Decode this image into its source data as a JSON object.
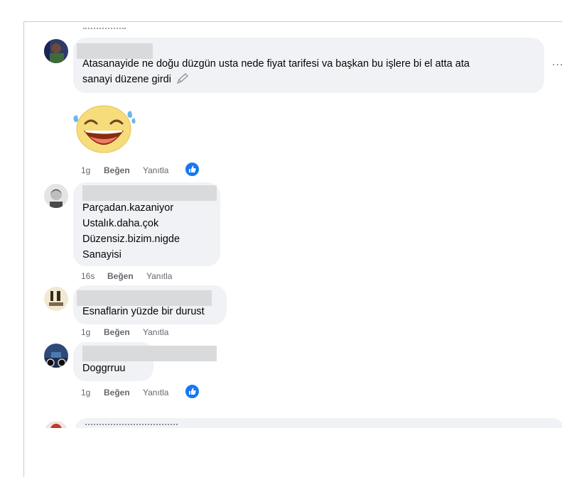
{
  "comments": [
    {
      "text_line1": "Atasanayide ne doğu düzgün usta nede fiyat tarifesi va başkan bu işlere bi el atta ata",
      "text_line2": "sanayi düzene girdi",
      "time": "1g",
      "like": "Beğen",
      "reply": "Yanıtla",
      "reaction": "like-icon",
      "sticker": "laughing-emoji-icon"
    },
    {
      "lines": [
        "Parçadan.kazaniyor",
        "Ustalık.daha.çok",
        "Düzensiz.bizim.nigde",
        "Sanayisi"
      ],
      "time": "16s",
      "like": "Beğen",
      "reply": "Yanıtla"
    },
    {
      "text": "Esnaflarin yüzde bir durust",
      "time": "1g",
      "like": "Beğen",
      "reply": "Yanıtla"
    },
    {
      "text": "Doggrruu",
      "time": "1g",
      "like": "Beğen",
      "reply": "Yanıtla",
      "reaction": "like-icon"
    }
  ],
  "more_options": "...",
  "colors": {
    "bubble": "#f0f2f5",
    "like_blue": "#1877f2",
    "meta": "#65676b"
  }
}
